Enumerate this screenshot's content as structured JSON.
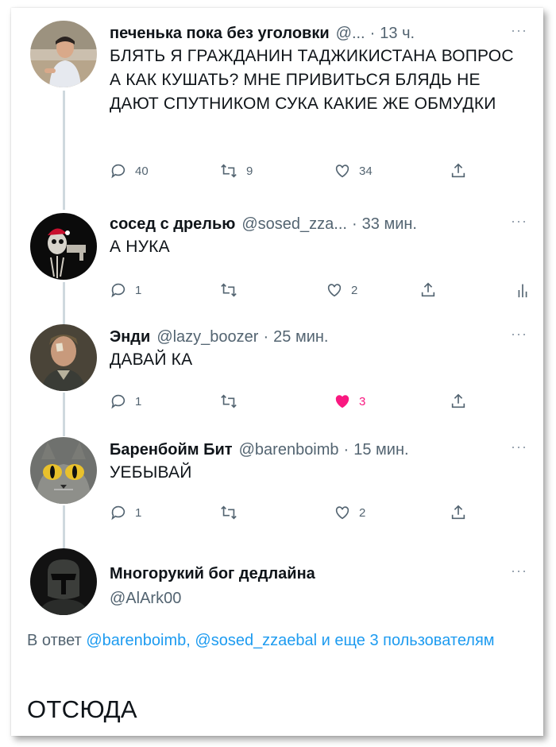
{
  "tweets": [
    {
      "name": "печенька пока без уголовки",
      "handle": "@...",
      "time": "13 ч.",
      "more": "···",
      "text": "БЛЯТЬ Я ГРАЖДАНИН ТАДЖИКИСТАНА ВОПРОС А КАК КУШАТЬ? МНЕ ПРИВИТЬСЯ БЛЯДЬ НЕ ДАЮТ СПУТНИКОМ СУКА КАКИЕ ЖЕ ОБМУДКИ",
      "replies": "40",
      "retweets": "9",
      "likes": "34"
    },
    {
      "name": "сосед с дрелью",
      "handle": "@sosed_zza...",
      "time": "33 мин.",
      "more": "···",
      "text": "А НУКА",
      "replies": "1",
      "retweets": "",
      "likes": "2"
    },
    {
      "name": "Энди",
      "handle": "@lazy_boozer",
      "time": "25 мин.",
      "more": "···",
      "text": "ДАВАЙ КА",
      "replies": "1",
      "retweets": "",
      "likes": "3",
      "liked": true
    },
    {
      "name": "Баренбойм Бит",
      "handle": "@barenboimb",
      "time": "15 мин.",
      "more": "···",
      "text": "УЕБЫВАЙ",
      "replies": "1",
      "retweets": "",
      "likes": "2"
    }
  ],
  "main_tweet": {
    "name": "Многорукий бог дедлайна",
    "handle": "@AlArk00",
    "more": "···",
    "reply_prefix": "В ответ ",
    "reply_user1": "@barenboimb",
    "reply_sep": ", ",
    "reply_user2": "@sosed_zzaebal",
    "reply_suffix": " и еще 3 пользователям",
    "text": "ОТСЮДА"
  },
  "icons": {
    "reply": "reply-bubble-icon",
    "retweet": "retweet-icon",
    "like": "heart-icon",
    "share": "share-icon",
    "analytics": "analytics-icon"
  },
  "colors": {
    "text": "#0f1419",
    "secondary": "#536471",
    "link": "#1d9bf0",
    "like": "#f91880"
  }
}
